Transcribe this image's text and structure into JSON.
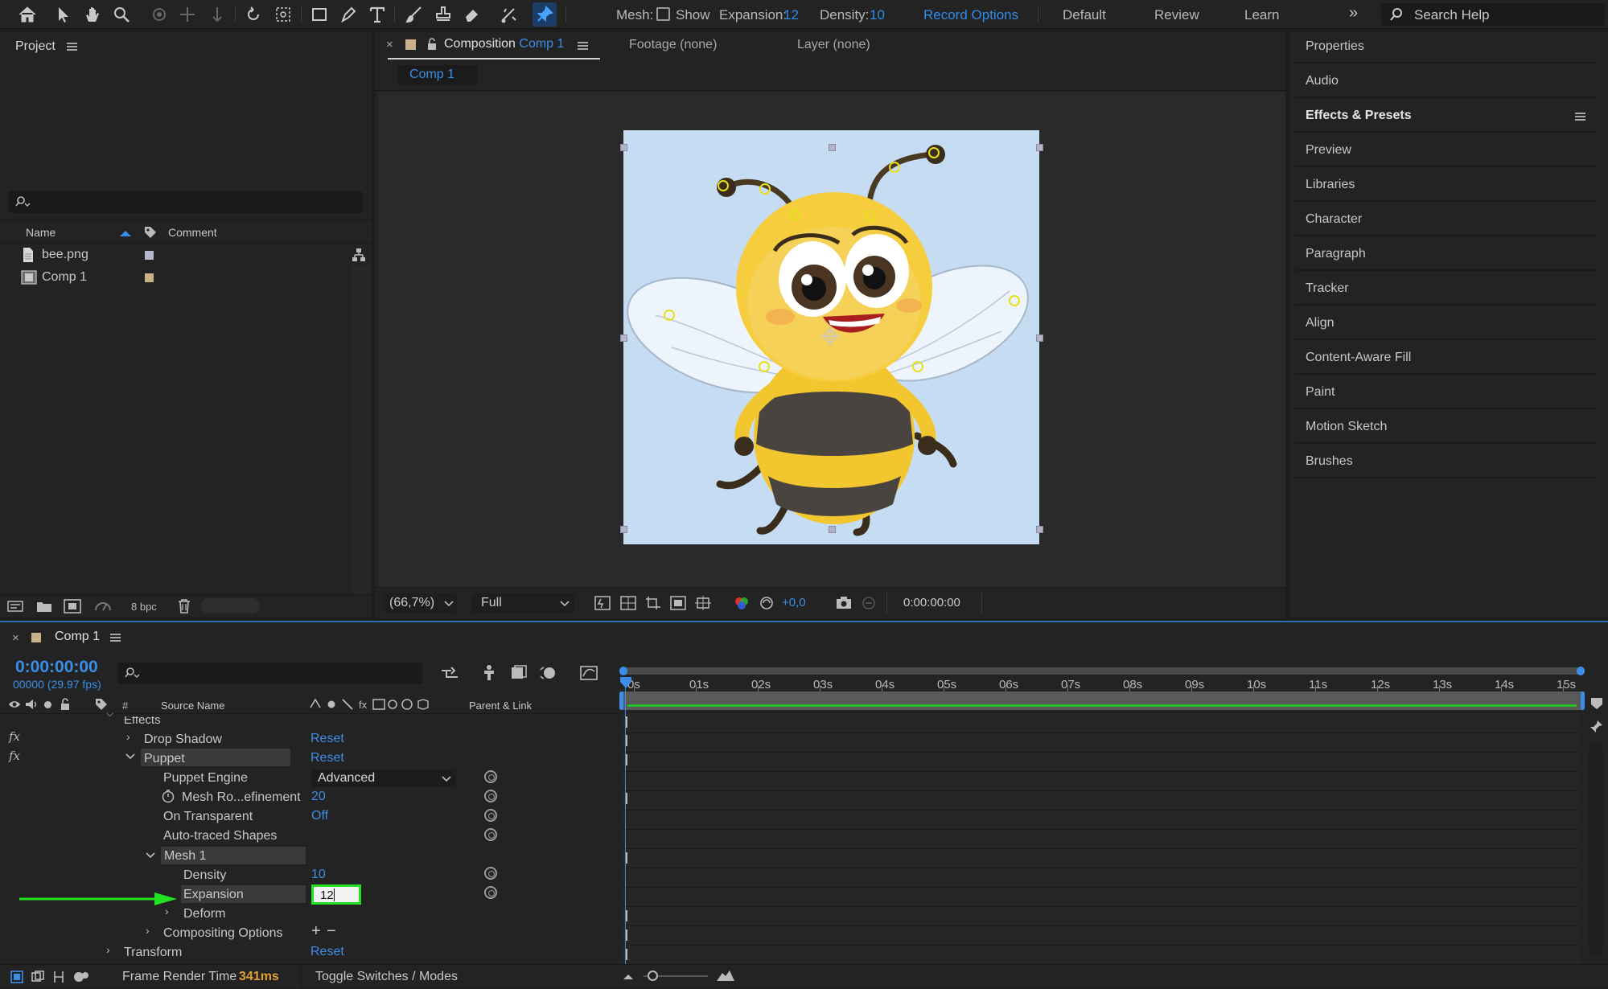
{
  "toolbar": {
    "mesh_label": "Mesh:",
    "show_label": "Show",
    "expansion_label": "Expansion:",
    "expansion_value": "12",
    "density_label": "Density:",
    "density_value": "10",
    "record_options": "Record Options",
    "workspaces": [
      "Default",
      "Review",
      "Learn"
    ],
    "search_placeholder": "Search Help"
  },
  "project": {
    "title": "Project",
    "columns": {
      "name": "Name",
      "comment": "Comment"
    },
    "items": [
      {
        "name": "bee.png",
        "type": "footage"
      },
      {
        "name": "Comp 1",
        "type": "composition"
      }
    ],
    "bpc": "8 bpc"
  },
  "viewer": {
    "tabs": {
      "composition_label": "Composition",
      "composition_name": "Comp 1",
      "footage": "Footage (none)",
      "layer": "Layer (none)"
    },
    "comp_tab": "Comp 1",
    "zoom": "(66,7%)",
    "resolution": "Full",
    "exposure": "+0,0",
    "timecode": "0:00:00:00"
  },
  "right_panel": {
    "items": [
      "Properties",
      "Audio",
      "Effects & Presets",
      "Preview",
      "Libraries",
      "Character",
      "Paragraph",
      "Tracker",
      "Align",
      "Content-Aware Fill",
      "Paint",
      "Motion Sketch",
      "Brushes"
    ]
  },
  "timeline": {
    "comp_name": "Comp 1",
    "timecode": "0:00:00:00",
    "frame_info": "00000 (29.97 fps)",
    "columns": {
      "num": "#",
      "source": "Source Name",
      "parent": "Parent & Link"
    },
    "ruler": [
      "0s",
      "01s",
      "02s",
      "03s",
      "04s",
      "05s",
      "06s",
      "07s",
      "08s",
      "09s",
      "10s",
      "11s",
      "12s",
      "13s",
      "14s",
      "15s"
    ],
    "rows": {
      "effects": "Effects",
      "drop_shadow": "Drop Shadow",
      "puppet": "Puppet",
      "reset": "Reset",
      "puppet_engine": "Puppet Engine",
      "puppet_engine_value": "Advanced",
      "mesh_refinement": "Mesh Ro...efinement",
      "mesh_refinement_value": "20",
      "on_transparent": "On Transparent",
      "on_transparent_value": "Off",
      "auto_traced": "Auto-traced Shapes",
      "mesh1": "Mesh 1",
      "density": "Density",
      "density_value": "10",
      "expansion": "Expansion",
      "expansion_value": "12",
      "deform": "Deform",
      "compositing": "Compositing Options",
      "transform": "Transform"
    },
    "footer": {
      "frame_render_label": "Frame Render Time",
      "frame_render_value": "341ms",
      "toggle": "Toggle Switches / Modes"
    }
  },
  "colors": {
    "accent_blue": "#2d8ceb",
    "highlight_green": "#22e022",
    "timeline_border": "#2f6db6"
  }
}
